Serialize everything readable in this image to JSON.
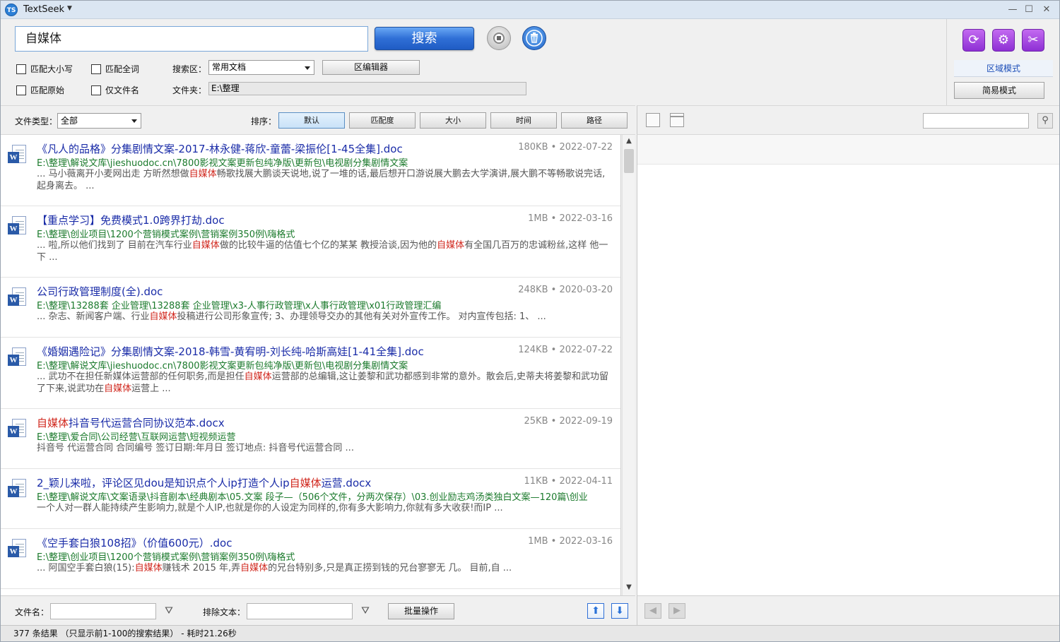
{
  "app": {
    "title": "TextSeek",
    "logo_text": "TS"
  },
  "window": {
    "min": "—",
    "max": "☐",
    "close": "✕"
  },
  "search": {
    "query": "自媒体",
    "search_label": "搜索",
    "opt_case": "匹配大小写",
    "opt_whole": "匹配全词",
    "opt_raw": "匹配原始",
    "opt_filename": "仅文件名",
    "zone_label": "搜索区：",
    "zone_value": "常用文档",
    "zone_editor": "区编辑器",
    "folder_label": "文件夹：",
    "folder_value": "E:\\整理"
  },
  "modes": {
    "zone_mode": "区域模式",
    "simple_mode": "简易模式"
  },
  "filter": {
    "type_label": "文件类型：",
    "type_value": "全部",
    "sort_label": "排序：",
    "sort": [
      "默认",
      "匹配度",
      "大小",
      "时间",
      "路径"
    ]
  },
  "results": [
    {
      "title_pre": "《凡人的品格》分集剧情文案-2017-林永健-蒋欣-童蕾-梁振伦[1-45全集].doc",
      "title_hl": "",
      "title_post": "",
      "size": "180KB",
      "date": "2022-07-22",
      "path": "E:\\整理\\解说文库\\jieshuodoc.cn\\7800影视文案更新包纯净版\\更新包\\电视剧分集剧情文案",
      "snip_pre": "... 马小薇离开小麦网出走 方昕然想做",
      "snip_hl": "自媒体",
      "snip_mid": "畅歌找展大鹏谈天说地,说了一堆的话,最后想开口游说展大鹏去大学演讲,展大鹏不等畅歌说完话,起身离去。 ...",
      "snip_hl2": "",
      "snip_post": ""
    },
    {
      "title_pre": "【重点学习】免费模式1.0跨界打劫.doc",
      "title_hl": "",
      "title_post": "",
      "size": "1MB",
      "date": "2022-03-16",
      "path": "E:\\整理\\创业项目\\1200个营销模式案例\\营销案例350例\\嗨格式",
      "snip_pre": "... 啦,所以他们找到了 目前在汽车行业",
      "snip_hl": "自媒体",
      "snip_mid": "做的比较牛逼的估值七个亿的某某 教授洽谈,因为他的",
      "snip_hl2": "自媒体",
      "snip_post": "有全国几百万的忠诚粉丝,这样 他一下 ..."
    },
    {
      "title_pre": "公司行政管理制度(全).doc",
      "title_hl": "",
      "title_post": "",
      "size": "248KB",
      "date": "2020-03-20",
      "path": "E:\\整理\\13288套 企业管理\\13288套 企业管理\\x3-人事行政管理\\x人事行政管理\\x01行政管理汇编",
      "snip_pre": "... 杂志、新闻客户端、行业",
      "snip_hl": "自媒体",
      "snip_mid": "投稿进行公司形象宣传; 3、办理领导交办的其他有关对外宣传工作。 对内宣传包括: 1、 ...",
      "snip_hl2": "",
      "snip_post": ""
    },
    {
      "title_pre": "《婚姻遇险记》分集剧情文案-2018-韩雪-黄宥明-刘长纯-哈斯高娃[1-41全集].doc",
      "title_hl": "",
      "title_post": "",
      "size": "124KB",
      "date": "2022-07-22",
      "path": "E:\\整理\\解说文库\\jieshuodoc.cn\\7800影视文案更新包纯净版\\更新包\\电视剧分集剧情文案",
      "snip_pre": "... 武功不在担任新媒体运营部的任何职务,而是担任",
      "snip_hl": "自媒体",
      "snip_mid": "运营部的总编辑,这让姜黎和武功都感到非常的意外。散会后,史蒂夫将姜黎和武功留了下来,说武功在",
      "snip_hl2": "自媒体",
      "snip_post": "运营上 ..."
    },
    {
      "title_pre": "",
      "title_hl": "自媒体",
      "title_post": "抖音号代运营合同协议范本.docx",
      "size": "25KB",
      "date": "2022-09-19",
      "path": "E:\\整理\\爱合同\\公司经营\\互联网运营\\短视频运营",
      "snip_pre": "抖音号 代运营合同 合同编号 签订日期:年月日 签订地点: 抖音号代运营合同 ...",
      "snip_hl": "",
      "snip_mid": "",
      "snip_hl2": "",
      "snip_post": ""
    },
    {
      "title_pre": "2_颖儿来啦，评论区见dou是知识点个人ip打造个人ip",
      "title_hl": "自媒体",
      "title_post": "运营.docx",
      "size": "11KB",
      "date": "2022-04-11",
      "path": "E:\\整理\\解说文库\\文案语录\\抖音剧本\\经典剧本\\05.文案 段子—（506个文件，分两次保存）\\03.创业励志鸡汤类独白文案—120篇\\创业",
      "snip_pre": "一个人对一群人能持续产生影响力,就是个人IP,也就是你的人设定为同样的,你有多大影响力,你就有多大收获!而IP ...",
      "snip_hl": "",
      "snip_mid": "",
      "snip_hl2": "",
      "snip_post": ""
    },
    {
      "title_pre": "《空手套白狼108招》（价值600元）.doc",
      "title_hl": "",
      "title_post": "",
      "size": "1MB",
      "date": "2022-03-16",
      "path": "E:\\整理\\创业项目\\1200个营销模式案例\\营销案例350例\\嗨格式",
      "snip_pre": "... 阿国空手套白狼(15):",
      "snip_hl": "自媒体",
      "snip_mid": "赚钱术 2015 年,弄",
      "snip_hl2": "自媒体",
      "snip_post": "的兄台特别多,只是真正捞到钱的兄台寥寥无 几。 目前,自 ..."
    }
  ],
  "bottom": {
    "filename_label": "文件名：",
    "exclude_label": "排除文本：",
    "batch_label": "批量操作"
  },
  "status": {
    "text": "377 条结果  （只显示前1-100的搜索结果） - 耗时21.26秒"
  }
}
